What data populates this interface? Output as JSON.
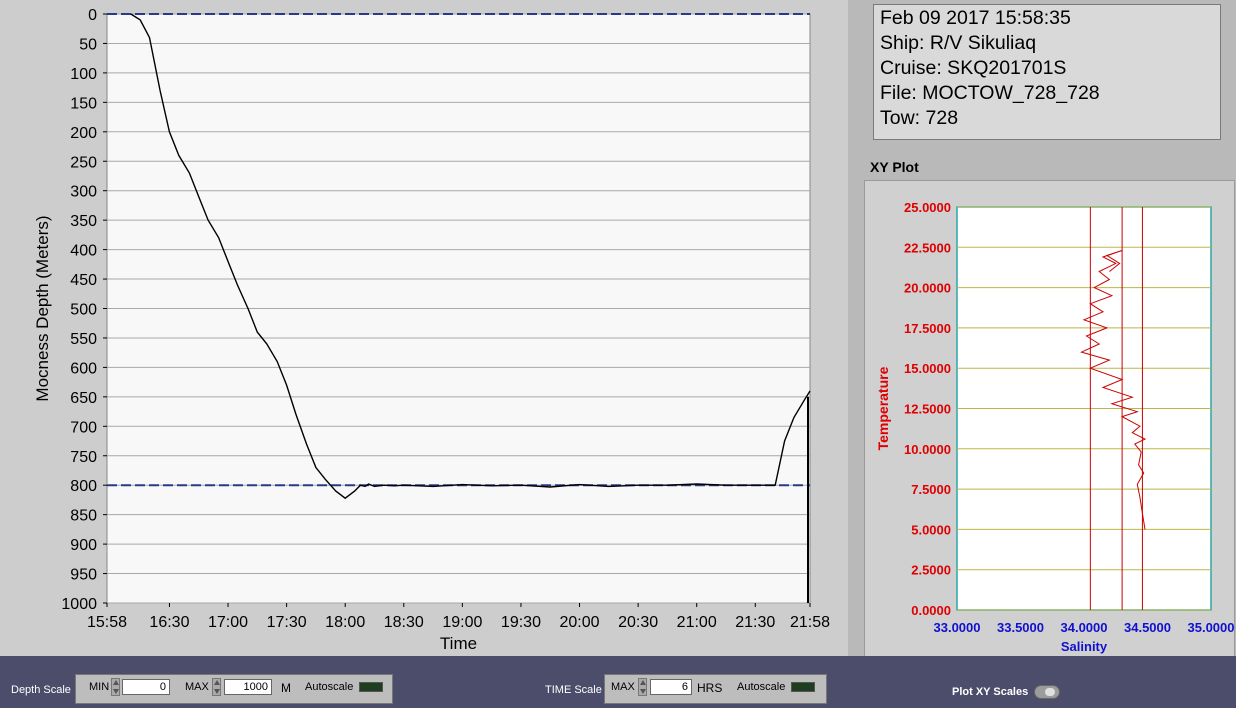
{
  "depth_chart": {
    "chart_data": {
      "type": "line",
      "ylabel": "Mocness Depth (Meters)",
      "xlabel": "Time",
      "ylim": [
        1000,
        0
      ],
      "yticks": [
        "0",
        "50",
        "100",
        "150",
        "200",
        "250",
        "300",
        "350",
        "400",
        "450",
        "500",
        "550",
        "600",
        "650",
        "700",
        "750",
        "800",
        "850",
        "900",
        "950",
        "1000"
      ],
      "xticks": [
        "15:58",
        "16:30",
        "17:00",
        "17:30",
        "18:00",
        "18:30",
        "19:00",
        "19:30",
        "20:00",
        "20:30",
        "21:00",
        "21:30",
        "21:58"
      ],
      "xtick_hours": [
        15.967,
        16.5,
        17.0,
        17.5,
        18.0,
        18.5,
        19.0,
        19.5,
        20.0,
        20.5,
        21.0,
        21.5,
        21.967
      ],
      "xlim_hours": [
        15.967,
        21.967
      ],
      "reference_lines": [
        0,
        800
      ],
      "series": [
        {
          "x_hours": [
            16.17,
            16.25,
            16.33,
            16.42,
            16.5,
            16.58,
            16.67,
            16.75,
            16.83,
            16.92,
            17.0,
            17.08,
            17.17,
            17.25,
            17.33,
            17.42,
            17.5,
            17.58,
            17.67,
            17.75,
            17.83,
            17.92,
            18.0,
            18.08,
            18.13,
            18.17,
            18.2,
            18.25,
            18.33,
            18.42,
            18.5,
            18.75,
            19.0,
            19.25,
            19.5,
            19.75,
            20.0,
            20.25,
            20.5,
            20.75,
            21.0,
            21.25,
            21.5,
            21.58,
            21.67,
            21.75,
            21.83,
            21.92,
            21.967
          ],
          "depth_m": [
            0,
            10,
            40,
            130,
            200,
            240,
            270,
            310,
            350,
            380,
            420,
            460,
            500,
            540,
            560,
            590,
            630,
            680,
            730,
            770,
            790,
            810,
            822,
            810,
            800,
            802,
            798,
            802,
            800,
            801,
            800,
            802,
            799,
            801,
            800,
            803,
            799,
            802,
            800,
            800,
            798,
            800,
            800,
            800,
            800,
            725,
            685,
            655,
            640
          ]
        }
      ],
      "color": "#000000"
    }
  },
  "info": {
    "date": "Feb 09 2017 15:58:35",
    "ship": "Ship: R/V Sikuliaq",
    "cruise": "Cruise: SKQ201701S",
    "file": "File: MOCTOW_728_728",
    "tow": "Tow: 728"
  },
  "xy_plot": {
    "title": "XY Plot",
    "chart_data": {
      "type": "line",
      "ylabel": "Temperature",
      "xlabel": "Salinity",
      "xlim": [
        33.0,
        35.0
      ],
      "ylim": [
        0.0,
        25.0
      ],
      "xticks": [
        "33.0000",
        "33.5000",
        "34.0000",
        "34.5000",
        "35.0000"
      ],
      "yticks": [
        "0.0000",
        "2.5000",
        "5.0000",
        "7.5000",
        "10.0000",
        "12.5000",
        "15.0000",
        "17.5000",
        "20.0000",
        "22.5000",
        "25.0000"
      ],
      "series": [
        {
          "salinity": [
            34.48,
            34.46,
            34.44,
            34.42,
            34.47,
            34.43,
            34.45,
            34.4,
            34.48,
            34.38,
            34.44,
            34.3,
            34.42,
            34.22,
            34.38,
            34.15,
            34.3,
            34.05,
            34.2,
            33.98,
            34.12,
            34.02,
            34.18,
            34.0,
            34.15,
            34.05,
            34.22,
            34.08,
            34.2,
            34.12,
            34.25,
            34.15,
            34.3,
            34.18,
            34.28,
            34.2
          ],
          "temperature": [
            5.0,
            6.0,
            7.0,
            7.8,
            8.5,
            9.0,
            9.8,
            10.3,
            10.6,
            11.0,
            11.4,
            12.0,
            12.3,
            12.8,
            13.2,
            13.8,
            14.3,
            15.0,
            15.5,
            16.0,
            16.5,
            17.0,
            17.5,
            18.0,
            18.5,
            19.0,
            19.5,
            20.0,
            20.5,
            21.0,
            21.5,
            21.9,
            22.3,
            22.0,
            21.5,
            21.0
          ]
        }
      ],
      "color": "#cc0000"
    }
  },
  "controls": {
    "depth_scale_label": "Depth Scale",
    "depth_min_label": "MIN",
    "depth_min_value": "0",
    "depth_max_label": "MAX",
    "depth_max_value": "1000",
    "depth_unit": "M",
    "depth_autoscale_label": "Autoscale",
    "time_scale_label": "TIME Scale",
    "time_max_label": "MAX",
    "time_max_value": "6",
    "time_unit": "HRS",
    "time_autoscale_label": "Autoscale",
    "plot_xy_scales_label": "Plot XY Scales"
  }
}
